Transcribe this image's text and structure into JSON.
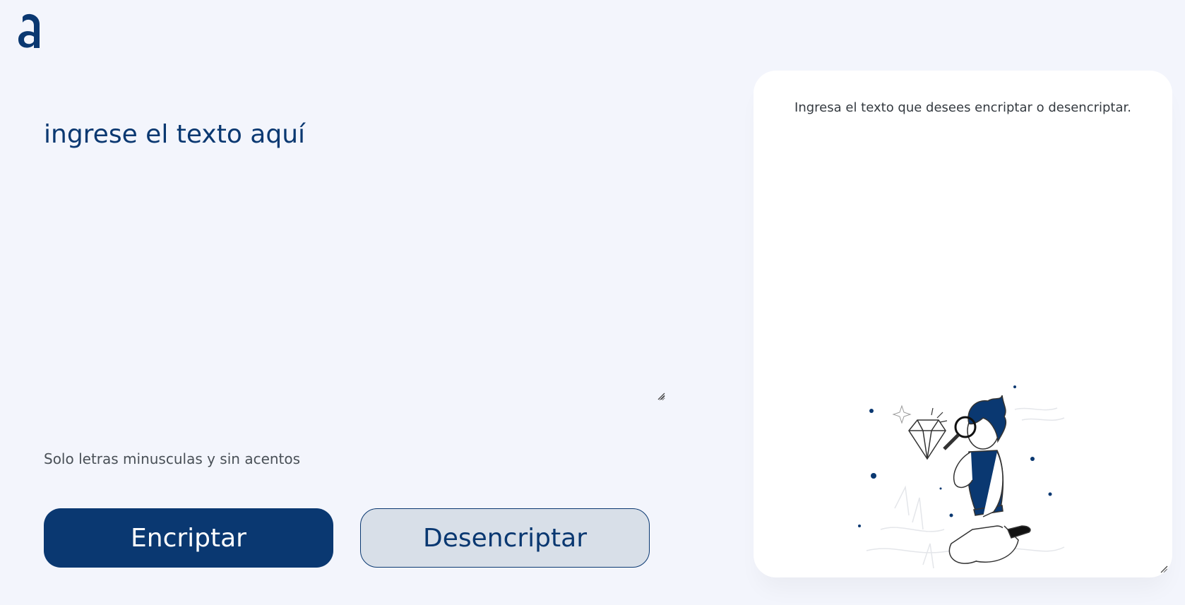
{
  "app": {
    "logo_icon": "alura-a-logo-icon"
  },
  "input": {
    "placeholder": "ingrese el texto aquí",
    "value": ""
  },
  "hint": {
    "text": "Solo letras minusculas y sin acentos"
  },
  "buttons": {
    "encrypt_label": "Encriptar",
    "decrypt_label": "Desencriptar"
  },
  "output": {
    "message": "Ingresa el texto que desees encriptar o desencriptar.",
    "illustration_icon": "person-with-magnifier-and-diamond-illustration"
  },
  "colors": {
    "primary": "#0a3871",
    "background": "#f3f5fc",
    "card": "#ffffff",
    "secondary_button": "#d8dfe8"
  }
}
